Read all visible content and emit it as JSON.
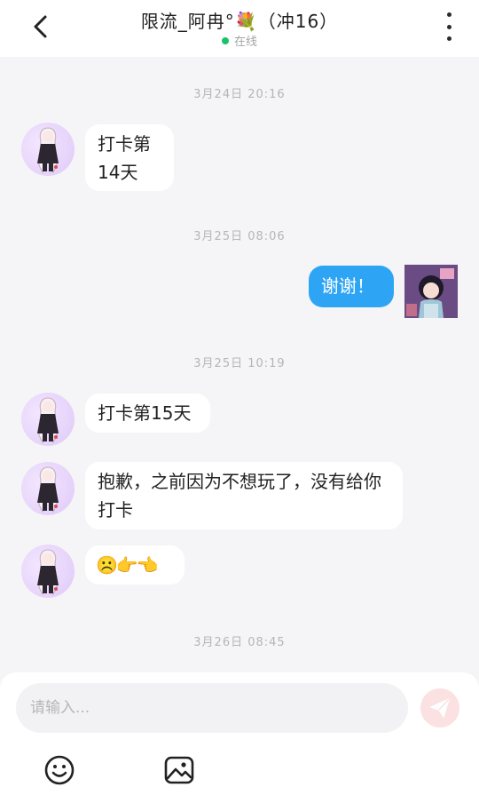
{
  "header": {
    "title": "限流_阿冉°💐（冲16）",
    "status": "在线"
  },
  "timestamps": [
    "3月24日 20:16",
    "3月25日 08:06",
    "3月25日 10:19",
    "3月26日 08:45"
  ],
  "messages": [
    {
      "from": "other",
      "text_line1": "打卡第",
      "text_line2": "14天"
    },
    {
      "from": "me",
      "text": "谢谢！"
    },
    {
      "from": "other",
      "text": "打卡第15天"
    },
    {
      "from": "other",
      "text": "抱歉，之前因为不想玩了，没有给你打卡"
    },
    {
      "from": "other",
      "text": "☹️👉👈"
    }
  ],
  "composer": {
    "placeholder": "请输入..."
  },
  "icons": {
    "back": "chevron-left-icon",
    "more": "more-vertical-icon",
    "send": "send-icon",
    "emoji": "emoji-icon",
    "image": "image-icon"
  },
  "colors": {
    "me_bubble": "#2ea5f4",
    "online": "#19c26b",
    "send_bg": "#fbe1e1"
  }
}
